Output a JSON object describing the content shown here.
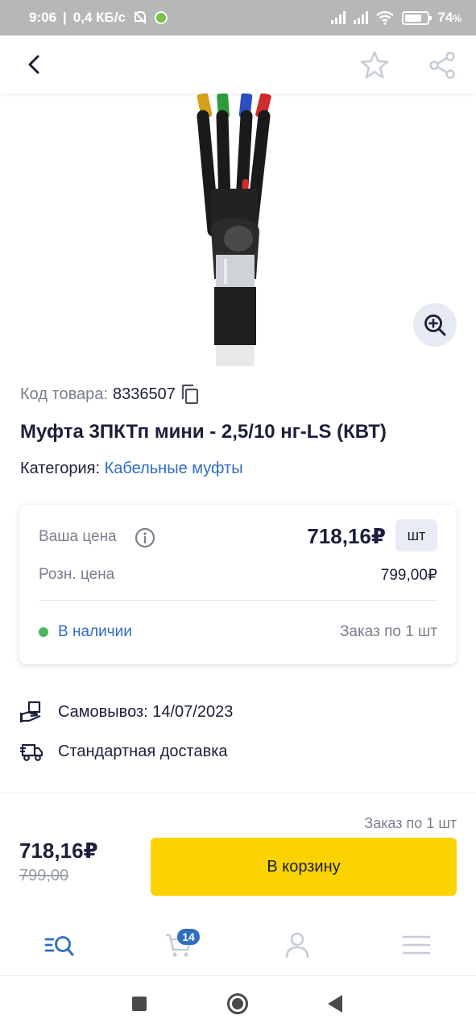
{
  "status_bar": {
    "time": "9:06",
    "speed": "0,4 КБ/с",
    "battery": "74"
  },
  "header": {
    "back_icon": "chevron-left-icon",
    "favorite_icon": "star-outline-icon",
    "share_icon": "share-icon"
  },
  "product": {
    "code_label": "Код товара:",
    "code_value": "8336507",
    "title": "Муфта 3ПКТп мини - 2,5/10 нг-LS (КВТ)",
    "category_label": "Категория:",
    "category_value": "Кабельные муфты",
    "image_icon": "cable-sleeve-photo",
    "wire_colors": [
      "#d6a11a",
      "#2a9d3a",
      "#2d4fc4",
      "#d12b2b"
    ]
  },
  "price_card": {
    "your_price_label": "Ваша цена",
    "your_price": "718,16₽",
    "unit": "шт",
    "retail_label": "Розн. цена",
    "retail_price": "799,00₽",
    "stock_status": "В наличии",
    "order_note": "Заказ по 1 шт"
  },
  "delivery": {
    "pickup": "Самовывоз: 14/07/2023",
    "standard": "Стандартная доставка"
  },
  "buy_bar": {
    "order_note": "Заказ по 1 шт",
    "price": "718,16₽",
    "old_price": "799,00",
    "cart_button": "В корзину"
  },
  "tab_bar": {
    "cart_badge": "14",
    "tabs": [
      "catalog-search-icon",
      "cart-icon",
      "profile-icon",
      "menu-icon"
    ]
  },
  "colors": {
    "accent": "#2f6ec2",
    "cta": "#fbd300",
    "in_stock": "#4fb35c",
    "text_dark": "#1b1f3b",
    "text_muted": "#7a7f8e"
  }
}
